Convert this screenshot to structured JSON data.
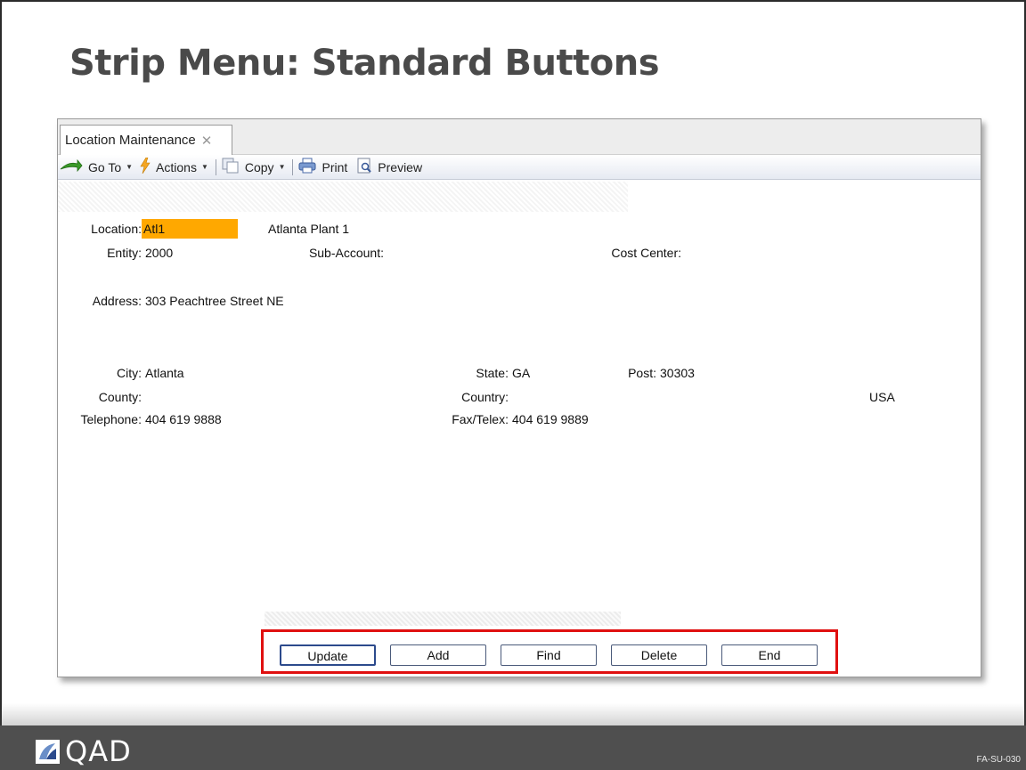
{
  "slide": {
    "title": "Strip Menu: Standard Buttons",
    "code": "FA-SU-030",
    "logo_text": "QAD"
  },
  "tab": {
    "label": "Location Maintenance",
    "close_glyph": "✕"
  },
  "toolbar": {
    "goto_label": "Go To",
    "actions_label": "Actions",
    "copy_label": "Copy",
    "print_label": "Print",
    "preview_label": "Preview",
    "dropdown_glyph": "▼"
  },
  "form": {
    "location_label": "Location:",
    "location_value": "Atl1",
    "location_desc": "Atlanta Plant 1",
    "entity_label": "Entity:",
    "entity_value": "2000",
    "subaccount_label": "Sub-Account:",
    "subaccount_value": "",
    "costcenter_label": "Cost Center:",
    "costcenter_value": "",
    "address_label": "Address:",
    "address_value": "303 Peachtree Street NE",
    "city_label": "City:",
    "city_value": "Atlanta",
    "state_label": "State:",
    "state_value": "GA",
    "post_label": "Post:",
    "post_value": "30303",
    "county_label": "County:",
    "county_value": "",
    "country_label": "Country:",
    "country_value": "USA",
    "telephone_label": "Telephone:",
    "telephone_value": "404 619 9888",
    "fax_label": "Fax/Telex:",
    "fax_value": "404 619 9889"
  },
  "buttons": {
    "update": "Update",
    "add": "Add",
    "find": "Find",
    "delete": "Delete",
    "end": "End"
  },
  "colors": {
    "highlight_field": "#ffa800",
    "strip_outline": "#e01010",
    "footer": "#4f4f4f"
  },
  "icons": {
    "goto": "green-arrow-icon",
    "actions": "lightning-icon",
    "copy": "copy-icon",
    "print": "printer-icon",
    "preview": "preview-icon"
  }
}
